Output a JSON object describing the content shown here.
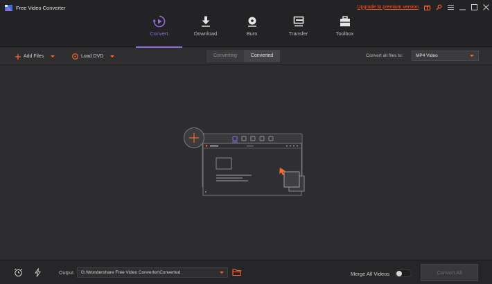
{
  "app": {
    "title": "Free Video Converter"
  },
  "window": {
    "upgrade_link": "Upgrade to premium version"
  },
  "nav": {
    "tabs": [
      {
        "label": "Convert",
        "icon": "convert-icon",
        "active": true
      },
      {
        "label": "Download",
        "icon": "download-icon",
        "active": false
      },
      {
        "label": "Burn",
        "icon": "burn-disc-icon",
        "active": false
      },
      {
        "label": "Transfer",
        "icon": "transfer-icon",
        "active": false
      },
      {
        "label": "Toolbox",
        "icon": "toolbox-icon",
        "active": false
      }
    ]
  },
  "toolbar": {
    "add_files": "Add Files",
    "load_dvd": "Load DVD",
    "seg_converting": "Converting",
    "seg_converted": "Converted",
    "convert_all_to_label": "Convert all files to:",
    "format_value": "MP4 Video"
  },
  "bottom": {
    "output_label": "Output",
    "output_path": "G:\\Wondershare Free Video Converter\\Converted",
    "merge_label": "Merge All Videos",
    "merge_enabled": false,
    "convert_all": "Convert All"
  },
  "colors": {
    "accent": "#8f6ddf",
    "brand_orange": "#ff6a2a",
    "upgrade_link": "#ff5a1f",
    "background": "#2d2d2f"
  }
}
